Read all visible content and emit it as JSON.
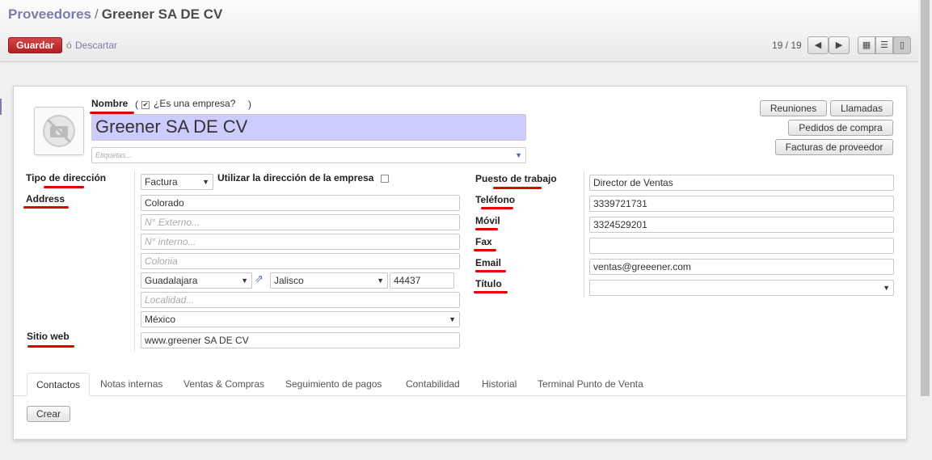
{
  "breadcrumb": {
    "parent": "Proveedores",
    "separator": "/",
    "current": "Greener SA DE CV"
  },
  "toolbar": {
    "save_label": "Guardar",
    "or_text": "ó",
    "discard_label": "Descartar"
  },
  "pager": {
    "text": "19 / 19",
    "prev_icon": "arrow-left-icon",
    "next_icon": "arrow-right-icon"
  },
  "view_switcher": {
    "kanban_icon": "grid-icon",
    "list_icon": "list-icon",
    "form_icon": "form-icon",
    "active": "form"
  },
  "form": {
    "name_label": "Nombre",
    "is_company_open": "(",
    "is_company_label": "¿Es una empresa?",
    "is_company_close": ")",
    "is_company_checked": true,
    "name_value": "Greener SA DE CV",
    "tags_placeholder": "Etiquetas...",
    "address_type_label": "Tipo de dirección",
    "address_type_value": "Factura",
    "use_company_address_label": "Utilizar la dirección de la empresa",
    "address_label": "Address",
    "street": "Colorado",
    "ext_number_placeholder": "N° Externo...",
    "int_number_placeholder": "N° interno...",
    "colony_placeholder": "Colonia",
    "city": "Guadalajara",
    "state": "Jalisco",
    "zip": "44437",
    "locality_placeholder": "Localidad...",
    "country": "México",
    "website_label": "Sitio web",
    "website": "www.greener SA DE CV",
    "job_label": "Puesto de trabajo",
    "job": "Director de Ventas",
    "phone_label": "Teléfono",
    "phone": "3339721731",
    "mobile_label": "Móvil",
    "mobile": "3324529201",
    "fax_label": "Fax",
    "fax": "",
    "email_label": "Email",
    "email": "ventas@greeener.com",
    "title_label": "Título",
    "title": ""
  },
  "smart_buttons": {
    "meetings": "Reuniones",
    "calls": "Llamadas",
    "purchase_orders": "Pedidos de compra",
    "supplier_invoices": "Facturas de proveedor"
  },
  "tabs": [
    "Contactos",
    "Notas internas",
    "Ventas & Compras",
    "Seguimiento de pagos",
    "Contabilidad",
    "Historial",
    "Terminal Punto de Venta"
  ],
  "contacts": {
    "create_label": "Crear"
  },
  "colors": {
    "accent": "#7c7bad",
    "save": "#c22b2b",
    "name_bg": "#ccccff",
    "annotation": "#e00000"
  }
}
